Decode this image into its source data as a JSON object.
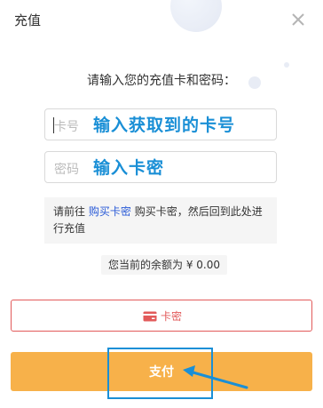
{
  "dialog": {
    "title": "充值",
    "prompt": "请输入您的充值卡和密码：",
    "card_field": {
      "placeholder": "卡号",
      "annotation": "输入获取到的卡号"
    },
    "password_field": {
      "placeholder": "密码",
      "annotation": "输入卡密"
    },
    "tip": {
      "prefix": "请前往",
      "link": "购买卡密",
      "suffix": "购买卡密，然后回到此处进行充值"
    },
    "balance": "您当前的余额为 ¥ 0.00",
    "method_tab": "卡密",
    "pay_button": "支付"
  },
  "colors": {
    "accent_blue": "#1a8fd6",
    "pay_orange": "#f7b14a",
    "card_red": "#e25a5a",
    "link_blue": "#2a5bd7"
  },
  "icons": [
    "close-icon",
    "card-icon",
    "annotation-arrow-icon"
  ]
}
